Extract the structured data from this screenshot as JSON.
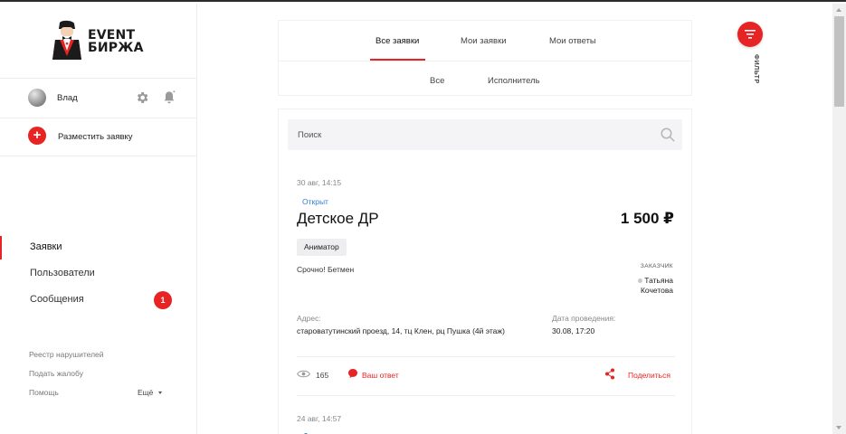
{
  "brand": {
    "line1": "EVENT",
    "line2": "БИРЖА",
    "accent": "#e82323"
  },
  "user": {
    "name": "Влад"
  },
  "sidebar": {
    "post_label": "Разместить заявку",
    "nav": [
      {
        "label": "Заявки",
        "active": true
      },
      {
        "label": "Пользователи"
      },
      {
        "label": "Сообщения",
        "badge": "1"
      }
    ],
    "links": [
      "Реестр нарушителей",
      "Подать жалобу",
      "Помощь"
    ],
    "more_label": "Ещё"
  },
  "tabs": [
    "Все заявки",
    "Мои заявки",
    "Мои ответы"
  ],
  "subtabs": [
    "Все",
    "Исполнитель"
  ],
  "search": {
    "placeholder": "Поиск",
    "value": ""
  },
  "orders": [
    {
      "date": "30 авг, 14:15",
      "status": "Открыт",
      "title": "Детское ДР",
      "price": "1 500 ₽",
      "tag": "Аниматор",
      "description": "Срочно! Бетмен",
      "customer_label": "ЗАКАЗЧИК",
      "customer_name": "Татьяна Кочетова",
      "address_label": "Адрес:",
      "address": "староватутинский проезд, 14, тц Клен, рц Пушка (4й этаж)",
      "event_date_label": "Дата проведения:",
      "event_date": "30.08, 17:20",
      "views": "165",
      "answer_label": "Ваш ответ",
      "share_label": "Поделиться"
    },
    {
      "date": "24 авг, 14:57"
    }
  ],
  "filter": {
    "label": "ФИЛЬТР"
  }
}
